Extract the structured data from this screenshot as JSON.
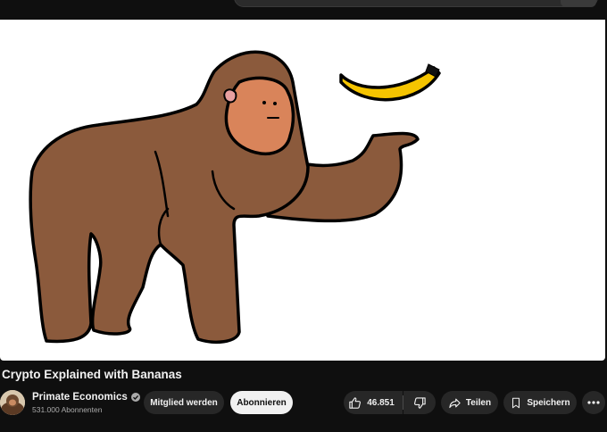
{
  "video": {
    "title": "Crypto Explained with Bananas"
  },
  "channel": {
    "name": "Primate Economics",
    "subscribers": "531.000 Abonnenten",
    "verified": true
  },
  "actions": {
    "member_label": "Mitglied werden",
    "subscribe_label": "Abonnieren",
    "like_count": "46.851",
    "share_label": "Teilen",
    "save_label": "Speichern"
  },
  "colors": {
    "background": "#0f0f0f",
    "pill": "#272727",
    "subscribe_bg": "#f1f1f1",
    "gorilla": "#8b5a3c",
    "banana": "#f5c400"
  }
}
